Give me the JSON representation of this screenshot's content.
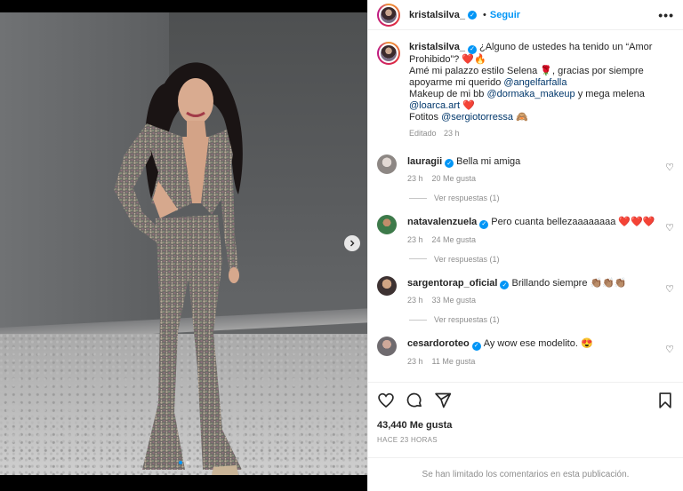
{
  "post": {
    "username": "kristalsilva_",
    "follow_label": "Seguir",
    "separator": "•",
    "more_label": "•••"
  },
  "caption": {
    "username": "kristalsilva_",
    "line1": "¿Alguno de ustedes ha tenido un “Amor Prohibido”? ❤️🔥",
    "line2a": "Amé mi palazzo estilo Selena 🌹, gracias por siempre apoyarme mi querido ",
    "mention1": "@angelfarfalla",
    "line3a": "Makeup de mi bb ",
    "mention2": "@dormaka_makeup",
    "line3b": " y mega melena ",
    "mention3": "@loarca.art",
    "line3c": " ❤️",
    "line4a": "Fotitos ",
    "mention4": "@sergiotorressa",
    "line4b": " 🙈",
    "edited": "Editado",
    "time": "23 h"
  },
  "comments": [
    {
      "username": "lauragii",
      "text": "Bella mi amiga",
      "time": "23 h",
      "likes": "20 Me gusta",
      "replies": "Ver respuestas (1)"
    },
    {
      "username": "natavalenzuela",
      "text": "Pero cuanta bellezaaaaaaaa ❤️❤️❤️",
      "time": "23 h",
      "likes": "24 Me gusta",
      "replies": "Ver respuestas (1)"
    },
    {
      "username": "sargentorap_oficial",
      "text": "Brillando siempre 👏🏽👏🏽👏🏽",
      "time": "23 h",
      "likes": "33 Me gusta",
      "replies": "Ver respuestas (1)"
    },
    {
      "username": "cesardoroteo",
      "text": "Ay wow ese modelito. 😍",
      "time": "23 h",
      "likes": "11 Me gusta"
    }
  ],
  "stats": {
    "likes": "43,440 Me gusta",
    "ago": "HACE 23 HORAS"
  },
  "footer": {
    "limited": "Se han limitado los comentarios en esta publicación."
  },
  "icons": {
    "verified": "verified-badge-icon",
    "heart": "heart-icon",
    "comment": "comment-icon",
    "share": "send-icon",
    "save": "bookmark-icon",
    "next": "chevron-right-icon"
  },
  "colors": {
    "accent": "#0095f6",
    "mention": "#00376b",
    "muted": "#8e8e8e"
  }
}
